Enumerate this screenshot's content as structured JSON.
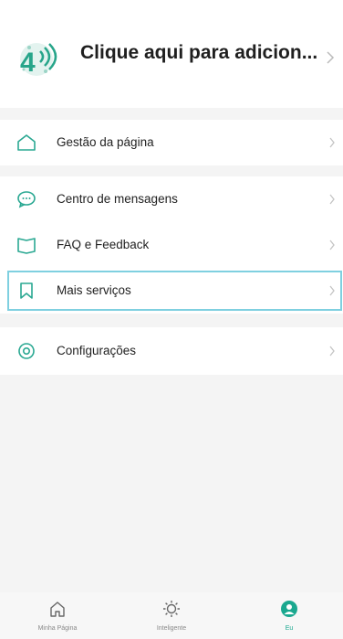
{
  "header": {
    "title": "Clique aqui para adicion...",
    "logo_icon": "4g-logo-icon"
  },
  "menu": {
    "page_management": {
      "label": "Gestão da página",
      "icon": "home-outline-icon"
    },
    "messages": {
      "label": "Centro de mensagens",
      "icon": "chat-bubble-icon"
    },
    "faq": {
      "label": "FAQ e Feedback",
      "icon": "book-icon"
    },
    "more_services": {
      "label": "Mais serviços",
      "icon": "bookmark-icon"
    },
    "settings": {
      "label": "Configurações",
      "icon": "settings-icon"
    }
  },
  "bottom_nav": {
    "items": [
      {
        "label": "Minha Página",
        "icon": "home-icon",
        "active": false
      },
      {
        "label": "Inteligente",
        "icon": "sun-icon",
        "active": false
      },
      {
        "label": "Eu",
        "icon": "user-icon",
        "active": true
      }
    ]
  },
  "colors": {
    "accent": "#1aa88f",
    "highlight_border": "#7fd0e0",
    "background": "#f4f4f4"
  }
}
